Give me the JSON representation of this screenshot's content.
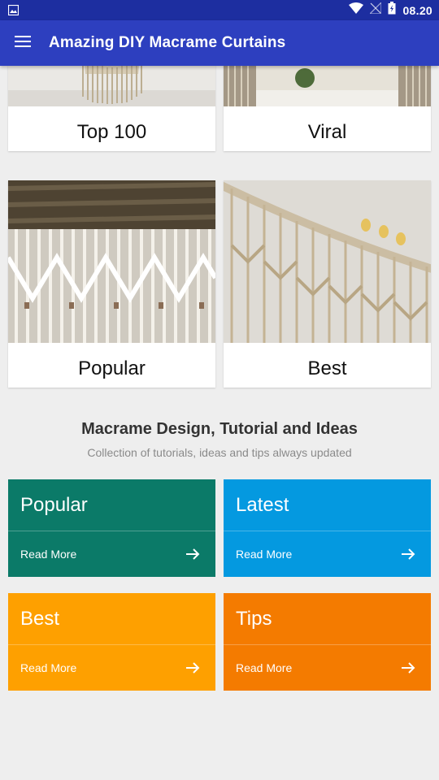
{
  "status_bar": {
    "time": "08.20"
  },
  "app_bar": {
    "title": "Amazing DIY Macrame Curtains"
  },
  "cards": [
    {
      "label": "Top 100"
    },
    {
      "label": "Viral"
    },
    {
      "label": "Popular"
    },
    {
      "label": "Best"
    }
  ],
  "section": {
    "title": "Macrame Design, Tutorial and Ideas",
    "subtitle": "Collection of tutorials, ideas and tips always updated"
  },
  "tiles": [
    {
      "title": "Popular",
      "more": "Read More",
      "color": "#0b7a68"
    },
    {
      "title": "Latest",
      "more": "Read More",
      "color": "#0499e0"
    },
    {
      "title": "Best",
      "more": "Read More",
      "color": "#fea000"
    },
    {
      "title": "Tips",
      "more": "Read More",
      "color": "#f47b00"
    }
  ]
}
